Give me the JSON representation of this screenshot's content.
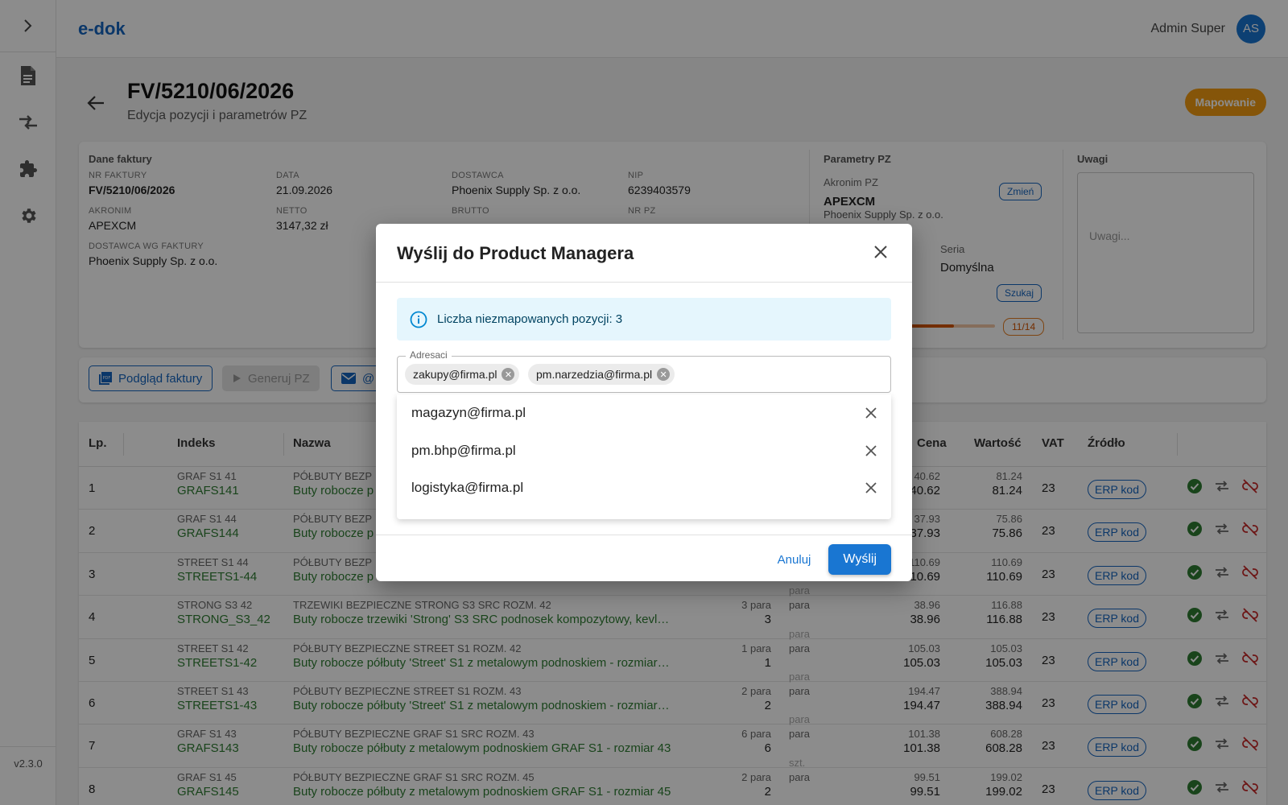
{
  "app": {
    "logo": "e-dok",
    "version": "v2.3.0",
    "user_name": "Admin Super",
    "user_initials": "AS"
  },
  "page": {
    "title": "FV/5210/06/2026",
    "subtitle": "Edycja pozycji i parametrów PZ",
    "status_button": "Mapowanie"
  },
  "invoice": {
    "heading": "Dane faktury",
    "fields": [
      {
        "label": "NR FAKTURY",
        "value": "FV/5210/06/2026"
      },
      {
        "label": "DATA",
        "value": "21.09.2026"
      },
      {
        "label": "DOSTAWCA",
        "value": "Phoenix Supply Sp. z o.o."
      },
      {
        "label": "NIP",
        "value": "6239403579"
      },
      {
        "label": "AKRONIM",
        "value": "APEXCM"
      },
      {
        "label": "NETTO",
        "value": "3147,32 zł"
      },
      {
        "label": "BRUTTO",
        "value": ""
      },
      {
        "label": "NR PZ",
        "value": ""
      },
      {
        "label": "DOSTAWCA WG FAKTURY",
        "value": "Phoenix Supply Sp. z o.o."
      }
    ]
  },
  "pz": {
    "heading": "Parametry PZ",
    "akronim_label": "Akronim PZ",
    "change_label": "Zmień",
    "akronim": "APEXCM",
    "supplier": "Phoenix Supply Sp. z o.o.",
    "seria_label": "Seria",
    "seria": "Domyślna",
    "search_label": "Szukaj",
    "progress_label": "11/14",
    "progress": 0.6
  },
  "notes": {
    "heading": "Uwagi",
    "placeholder": "Uwagi..."
  },
  "toolbar": {
    "preview": "Podgląd faktury",
    "generate": "Generuj PZ",
    "email": "@"
  },
  "table": {
    "headers": [
      "Lp.",
      "Indeks",
      "Nazwa",
      "Cena",
      "Wartość",
      "VAT",
      "Źródło"
    ],
    "rows": [
      {
        "lp": "1",
        "code": "GRAF S1 41",
        "index": "GRAFS141",
        "name_src": "PÓŁBUTY BEZP",
        "name": "Buty robocze p",
        "qty_src": "",
        "qty": "",
        "unit": "",
        "unit_prev": "",
        "price_src": "40.62",
        "price": "40.62",
        "value_src": "81.24",
        "value": "81.24",
        "vat": "23",
        "source": "ERP kod"
      },
      {
        "lp": "2",
        "code": "GRAF S1 44",
        "index": "GRAFS144",
        "name_src": "PÓŁBUTY BEZP",
        "name": "Buty robocze p",
        "qty_src": "",
        "qty": "",
        "unit": "",
        "unit_prev": "",
        "price_src": "37.93",
        "price": "37.93",
        "value_src": "75.86",
        "value": "75.86",
        "vat": "23",
        "source": "ERP kod"
      },
      {
        "lp": "3",
        "code": "STREET S1 44",
        "index": "STREETS1-44",
        "name_src": "PÓŁBUTY BEZP",
        "name": "Buty robocze p",
        "qty_src": "",
        "qty": "",
        "unit": "",
        "unit_prev": "",
        "price_src": "110.69",
        "price": "110.69",
        "value_src": "110.69",
        "value": "110.69",
        "vat": "23",
        "source": "ERP kod"
      },
      {
        "lp": "4",
        "code": "STRONG S3 42",
        "index": "STRONG_S3_42",
        "name_src": "TRZEWIKI BEZPIECZNE STRONG S3 SRC ROZM. 42",
        "name": "Buty robocze trzewiki 'Strong' S3 SRC podnosek kompozytowy, kevl…",
        "qty_src": "3 para",
        "qty": "3",
        "unit": "para",
        "unit_prev": "para",
        "price_src": "38.96",
        "price": "38.96",
        "value_src": "116.88",
        "value": "116.88",
        "vat": "23",
        "source": "ERP kod"
      },
      {
        "lp": "5",
        "code": "STREET S1 42",
        "index": "STREETS1-42",
        "name_src": "PÓŁBUTY BEZPIECZNE STREET S1 ROZM. 42",
        "name": "Buty robocze półbuty 'Street' S1 z metalowym podnoskiem - rozmiar…",
        "qty_src": "1 para",
        "qty": "1",
        "unit": "para",
        "unit_prev": "para",
        "price_src": "105.03",
        "price": "105.03",
        "value_src": "105.03",
        "value": "105.03",
        "vat": "23",
        "source": "ERP kod"
      },
      {
        "lp": "6",
        "code": "STREET S1 43",
        "index": "STREETS1-43",
        "name_src": "PÓŁBUTY BEZPIECZNE STREET S1 ROZM. 43",
        "name": "Buty robocze półbuty 'Street' S1 z metalowym podnoskiem - rozmiar…",
        "qty_src": "2 para",
        "qty": "2",
        "unit": "para",
        "unit_prev": "para",
        "price_src": "194.47",
        "price": "194.47",
        "value_src": "388.94",
        "value": "388.94",
        "vat": "23",
        "source": "ERP kod"
      },
      {
        "lp": "7",
        "code": "GRAF S1 43",
        "index": "GRAFS143",
        "name_src": "PÓŁBUTY BEZPIECZNE GRAF S1 SRC ROZM. 43",
        "name": "Buty robocze półbuty z metalowym podnoskiem GRAF S1 - rozmiar 43",
        "qty_src": "6 para",
        "qty": "6",
        "unit": "para",
        "unit_prev": "para",
        "price_src": "101.38",
        "price": "101.38",
        "value_src": "608.28",
        "value": "608.28",
        "vat": "23",
        "source": "ERP kod"
      },
      {
        "lp": "8",
        "code": "GRAF S1 45",
        "index": "GRAFS145",
        "name_src": "PÓŁBUTY BEZPIECZNE GRAF S1 SRC ROZM. 45",
        "name": "Buty robocze półbuty z metalowym podnoskiem GRAF S1 - rozmiar 45",
        "qty_src": "2 para",
        "qty": "2",
        "unit": "para",
        "unit_prev": "szt.",
        "price_src": "99.51",
        "price": "99.51",
        "value_src": "199.02",
        "value": "199.02",
        "vat": "23",
        "source": "ERP kod"
      }
    ]
  },
  "dialog": {
    "title": "Wyślij do Product Managera",
    "alert": "Liczba niezmapowanych pozycji: 3",
    "recipients_label": "Adresaci",
    "chips": [
      "zakupy@firma.pl",
      "pm.narzedzia@firma.pl"
    ],
    "suggestions": [
      "magazyn@firma.pl",
      "pm.bhp@firma.pl",
      "logistyka@firma.pl"
    ],
    "cancel": "Anuluj",
    "send": "Wyślij"
  },
  "colors": {
    "primary": "#1976d2",
    "accent_orange": "#f39c12",
    "success": "#2e7d32",
    "danger": "#c62828"
  }
}
